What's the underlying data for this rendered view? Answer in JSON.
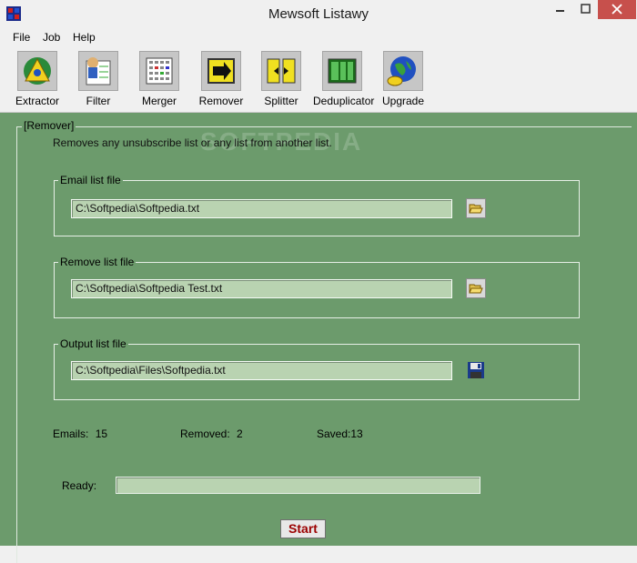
{
  "window": {
    "title": "Mewsoft Listawy"
  },
  "menu": [
    "File",
    "Job",
    "Help"
  ],
  "toolbar": {
    "items": [
      {
        "label": "Extractor",
        "icon": "extractor-icon"
      },
      {
        "label": "Filter",
        "icon": "filter-icon"
      },
      {
        "label": "Merger",
        "icon": "merger-icon"
      },
      {
        "label": "Remover",
        "icon": "remover-icon"
      },
      {
        "label": "Splitter",
        "icon": "splitter-icon"
      },
      {
        "label": "Deduplicator",
        "icon": "deduplicator-icon"
      },
      {
        "label": "Upgrade",
        "icon": "upgrade-icon"
      }
    ]
  },
  "remover": {
    "group_title": "[Remover]",
    "description": "Removes any unsubscribe list or any list from another list.",
    "email_list": {
      "label": "Email list file",
      "value": "C:\\Softpedia\\Softpedia.txt"
    },
    "remove_list": {
      "label": "Remove list file",
      "value": "C:\\Softpedia\\Softpedia Test.txt"
    },
    "output_list": {
      "label": "Output list file",
      "value": "C:\\Softpedia\\Files\\Softpedia.txt"
    },
    "stats": {
      "emails_label": "Emails:",
      "emails_value": "15",
      "removed_label": "Removed:",
      "removed_value": "2",
      "saved_label": "Saved:",
      "saved_value": "13"
    },
    "status": {
      "label": "Ready:",
      "progress": 0
    },
    "start_label": "Start"
  },
  "watermark": "SOFTPEDIA",
  "colors": {
    "panel": "#6c9b6c",
    "field": "#b9d3b1",
    "close": "#c7504c",
    "start_text": "#9b0000"
  }
}
